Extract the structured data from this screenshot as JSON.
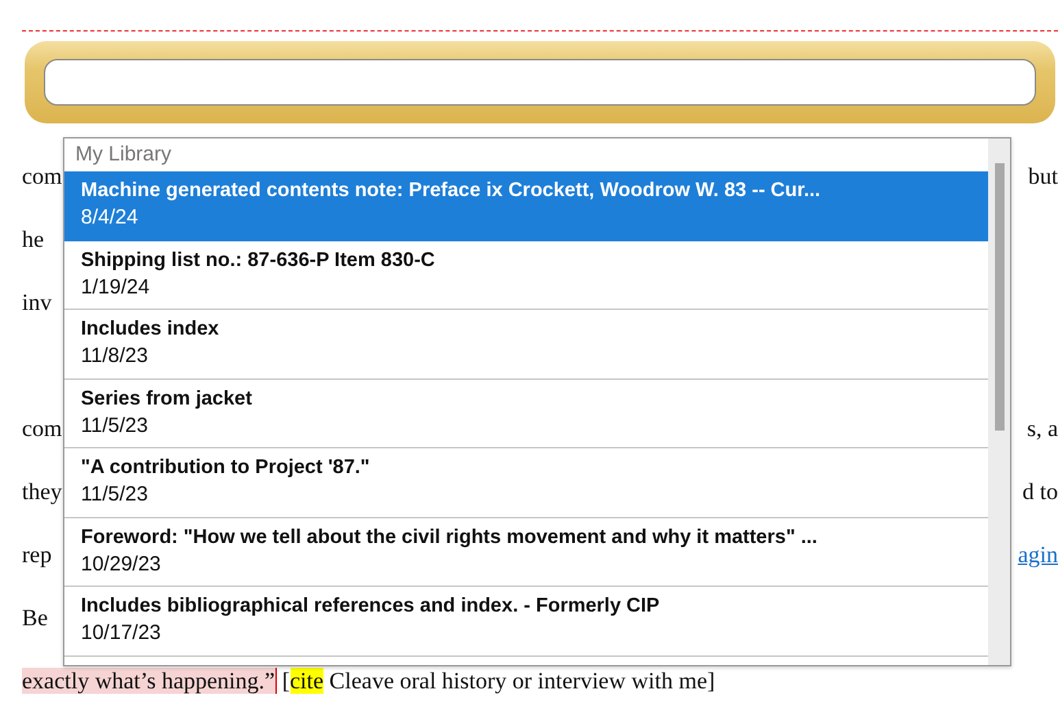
{
  "document": {
    "lines": [
      {
        "left": "com",
        "right": "but"
      },
      {
        "left": "he"
      },
      {
        "left": "inv"
      },
      {
        "kind": "blank"
      },
      {
        "left": "com",
        "right": "s, a"
      },
      {
        "left": "they",
        "right": "d to"
      },
      {
        "left": "rep",
        "right": "agin",
        "kind": "link"
      },
      {
        "left": "Be"
      }
    ],
    "last_line": {
      "segments": [
        {
          "text": "exactly what’s happening.”",
          "kind": "comment",
          "cursor_after": true
        },
        {
          "text": " [",
          "kind": "plain",
          "cursor_after": false
        },
        {
          "text": "cite",
          "kind": "citation",
          "cursor_after": false
        },
        {
          "text": " Cleave oral history or interview with me]",
          "kind": "plain",
          "cursor_after": false
        }
      ]
    }
  },
  "citation_picker": {
    "library": {
      "header": "My Library",
      "items": [
        {
          "title": "Machine generated contents note: Preface ix Crockett, Woodrow W. 83 -- Cur...",
          "date": "8/4/24",
          "selected": true
        },
        {
          "title": "Shipping list no.: 87-636-P Item 830-C",
          "date": "1/19/24",
          "selected": false
        },
        {
          "title": "Includes index",
          "date": "11/8/23",
          "selected": false
        },
        {
          "title": "Series from jacket",
          "date": "11/5/23",
          "selected": false
        },
        {
          "title": "\"A contribution to Project '87.\"",
          "date": "11/5/23",
          "selected": false
        },
        {
          "title": "Foreword: \"How we tell about the civil rights movement and why it matters\" ...",
          "date": "10/29/23",
          "selected": false
        },
        {
          "title": "Includes bibliographical references and index. - Formerly CIP",
          "date": "10/17/23",
          "selected": false
        }
      ]
    }
  }
}
